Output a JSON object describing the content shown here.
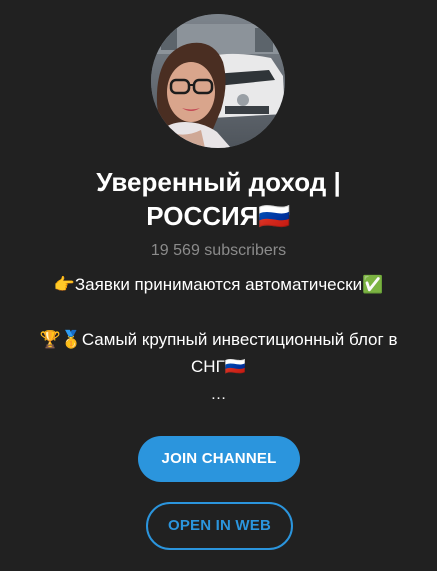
{
  "channel": {
    "title_line1": "Уверенный доход |",
    "title_line2": "РОССИЯ🇷🇺",
    "subscribers": "19 569 subscribers"
  },
  "description": {
    "line1": "👉Заявки принимаются автоматически✅",
    "line2": "🏆🥇Самый крупный инвестиционный блог в",
    "line3": "СНГ🇷🇺",
    "line4": "…"
  },
  "buttons": {
    "join": "JOIN CHANNEL",
    "open_web": "OPEN IN WEB"
  },
  "colors": {
    "background": "#212121",
    "accent": "#2b95dd",
    "muted_text": "#8b8b8b"
  }
}
